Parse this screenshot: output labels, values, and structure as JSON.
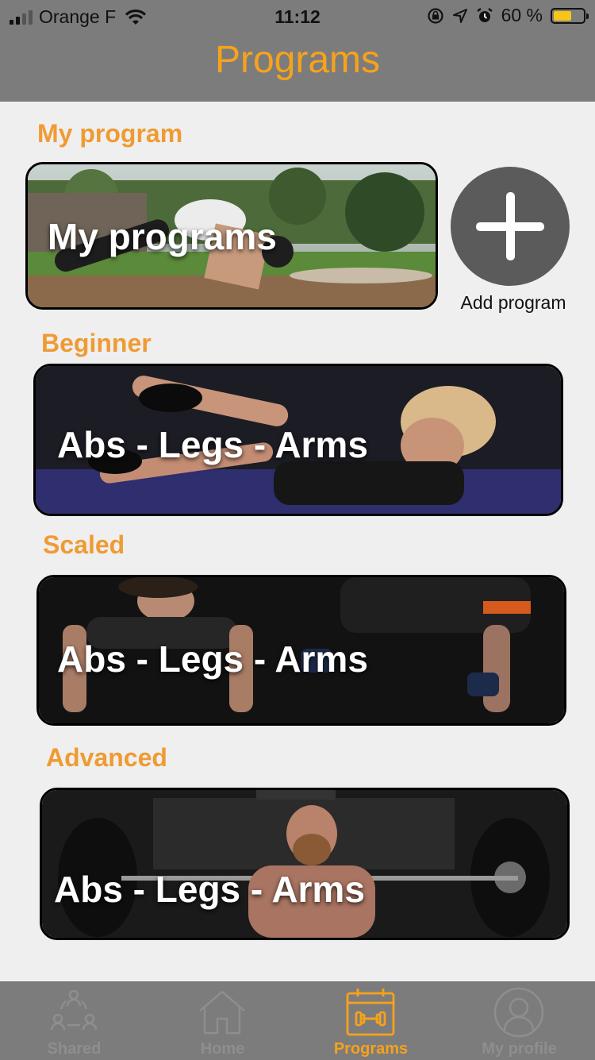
{
  "status_bar": {
    "carrier": "Orange F",
    "time": "11:12",
    "battery_percent": "60 %",
    "battery_level": 0.6,
    "icons": [
      "wifi-icon",
      "rotation-lock-icon",
      "location-icon",
      "alarm-icon",
      "battery-icon"
    ]
  },
  "header": {
    "title": "Programs"
  },
  "sections": {
    "my_program": {
      "label": "My program",
      "card_title": "My programs"
    },
    "add_program": {
      "label": "Add program"
    },
    "beginner": {
      "label": "Beginner",
      "card_title": "Abs - Legs - Arms"
    },
    "scaled": {
      "label": "Scaled",
      "card_title": "Abs - Legs - Arms"
    },
    "advanced": {
      "label": "Advanced",
      "card_title": "Abs - Legs - Arms"
    }
  },
  "tabbar": {
    "tabs": [
      {
        "label": "Shared",
        "icon": "shared-users-icon",
        "active": false
      },
      {
        "label": "Home",
        "icon": "home-icon",
        "active": false
      },
      {
        "label": "Programs",
        "icon": "calendar-dumbbell-icon",
        "active": true
      },
      {
        "label": "My profile",
        "icon": "profile-icon",
        "active": false
      }
    ]
  },
  "colors": {
    "accent": "#f7a21b",
    "section_label": "#ef9b33",
    "header_bg": "#7c7c7c",
    "background": "#efefef"
  }
}
